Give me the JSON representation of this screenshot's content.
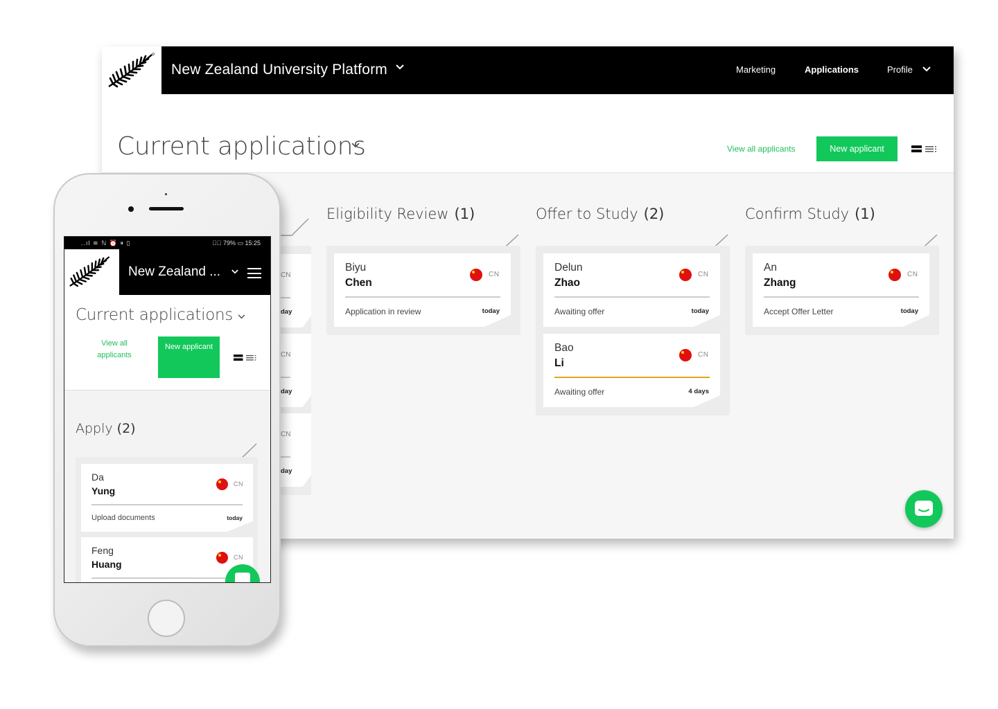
{
  "desktop": {
    "nav": {
      "title": "New Zealand University Platform",
      "items": [
        {
          "label": "Marketing",
          "active": false
        },
        {
          "label": "Applications",
          "active": true
        },
        {
          "label": "Profile",
          "active": false
        }
      ]
    },
    "header": {
      "title": "Current applications",
      "view_all": "View all applicants",
      "new_button": "New applicant"
    },
    "columns": [
      {
        "title": "Eligibility Review",
        "count": "(1)",
        "cards": [
          {
            "first": "Biyu",
            "last": "Chen",
            "country": "CN",
            "status": "Application in review",
            "when": "today",
            "warn": false
          }
        ]
      },
      {
        "title": "Offer to Study",
        "count": "(2)",
        "cards": [
          {
            "first": "Delun",
            "last": "Zhao",
            "country": "CN",
            "status": "Awaiting offer",
            "when": "today",
            "warn": false
          },
          {
            "first": "Bao",
            "last": "Li",
            "country": "CN",
            "status": "Awaiting offer",
            "when": "4 days",
            "warn": true
          }
        ]
      },
      {
        "title": "Confirm Study",
        "count": "(1)",
        "cards": [
          {
            "first": "An",
            "last": "Zhang",
            "country": "CN",
            "status": "Accept Offer Letter",
            "when": "today",
            "warn": false
          }
        ]
      }
    ],
    "partial_cards": [
      {
        "country": "CN",
        "when": "day"
      },
      {
        "country": "CN",
        "when": "day"
      },
      {
        "country": "CN",
        "when": "day"
      }
    ]
  },
  "mobile": {
    "status_bar": {
      "left": "..ıl ≋ ℕ ⏰ ⏸ ▯",
      "right": "▯⃞ 79% ▭ 15:25"
    },
    "nav": {
      "title": "New Zealand ..."
    },
    "header": {
      "title": "Current applications",
      "view_all": "View all applicants",
      "new_button": "New applicant"
    },
    "column": {
      "title": "Apply",
      "count": "(2)",
      "cards": [
        {
          "first": "Da",
          "last": "Yung",
          "country": "CN",
          "status": "Upload documents",
          "when": "today"
        },
        {
          "first": "Feng",
          "last": "Huang",
          "country": "CN",
          "status": "",
          "when": ""
        }
      ]
    }
  },
  "colors": {
    "accent": "#12c85b",
    "nav": "#000000",
    "warning": "#e8a21c",
    "flag": "#e01010"
  }
}
